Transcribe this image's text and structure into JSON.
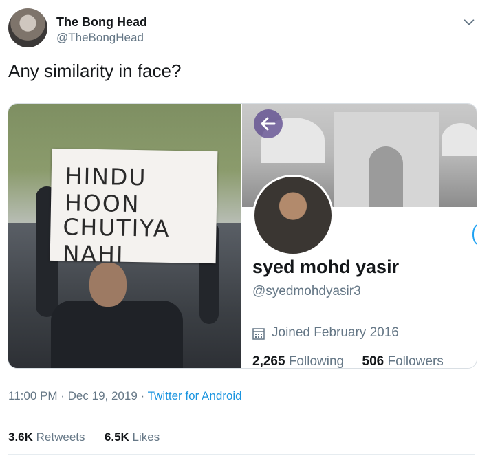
{
  "author": {
    "name": "The Bong Head",
    "handle": "@TheBongHead"
  },
  "tweet": {
    "text": "Any similarity in face?",
    "time": "11:00 PM",
    "date": "Dec 19, 2019",
    "source": "Twitter for Android",
    "separator": "·"
  },
  "media": {
    "placard_line1": "HINDU  HOON",
    "placard_line2": "CHUTIYA  NAHI",
    "profile": {
      "name": "syed mohd yasir",
      "handle": "@syedmohdyasir3",
      "joined": "Joined February 2016",
      "following_count": "2,265",
      "following_label": "Following",
      "followers_count": "506",
      "followers_label": "Followers"
    }
  },
  "stats": {
    "retweets_count": "3.6K",
    "retweets_label": "Retweets",
    "likes_count": "6.5K",
    "likes_label": "Likes"
  },
  "icons": {
    "caret": "chevron-down-icon",
    "calendar": "calendar-icon",
    "back": "back-arrow-icon"
  },
  "colors": {
    "link": "#1b95e0",
    "secondary_text": "#657786",
    "primary_text": "#14171a"
  }
}
